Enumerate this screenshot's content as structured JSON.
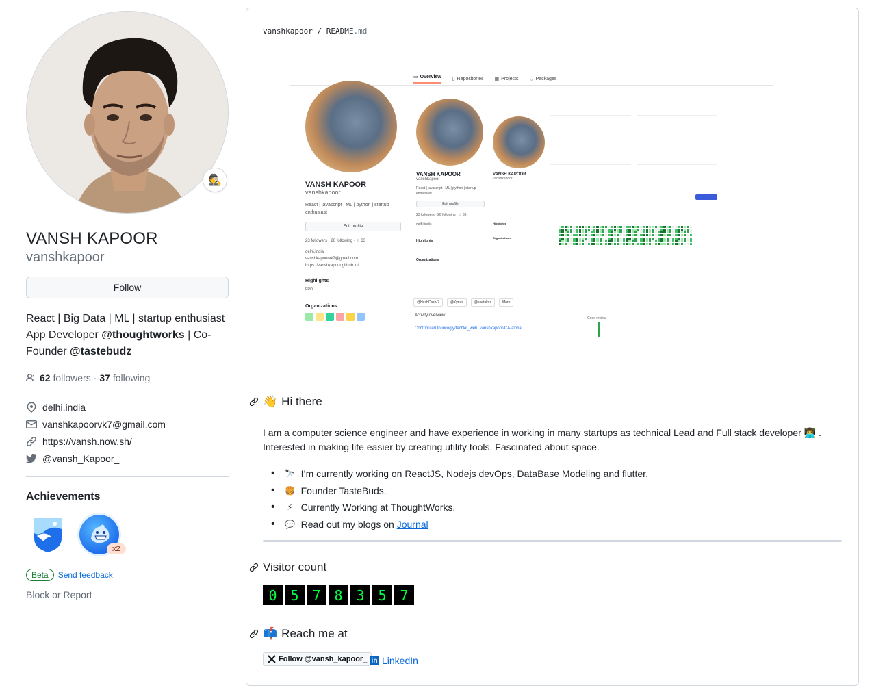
{
  "profile": {
    "name": "VANSH KAPOOR",
    "login": "vanshkapoor",
    "follow_label": "Follow",
    "bio_line1": "React | Big Data | ML | startup enthusiast",
    "bio_line2_pre": "App Developer ",
    "bio_org1": "@thoughtworks",
    "bio_line2_post": " | Co-",
    "bio_line3_pre": "Founder ",
    "bio_org2": "@tastebudz",
    "followers_count": "62",
    "followers_label": "followers",
    "following_count": "37",
    "following_label": "following",
    "location": "delhi,india",
    "email": "vanshkapoorvk7@gmail.com",
    "website": "https://vansh.now.sh/",
    "twitter": "@vansh_Kapoor_",
    "status_emoji": "🕵"
  },
  "achievements": {
    "title": "Achievements",
    "badge2_count": "x2",
    "beta_label": "Beta",
    "feedback_label": "Send feedback",
    "block_label": "Block or Report"
  },
  "readme": {
    "path_user": "vanshkapoor",
    "path_sep": " / ",
    "path_file": "README",
    "path_ext": ".md",
    "shot": {
      "tabs": [
        "Overview",
        "Repositories",
        "Projects",
        "Packages"
      ],
      "name": "VANSH KAPOOR",
      "login": "vanshkapoor",
      "bio": "React | javascript | ML | python | startup enthusiast",
      "edit": "Edit profile",
      "followers": "23 followers · 26 following · ☆ 33",
      "location": "delhi,india",
      "email": "vanshkapoorvk7@gmail.com",
      "site": "https://vanshkapoor.github.io/",
      "highlights": "Highlights",
      "pro": "PRO",
      "orgs": "Organizations",
      "activity": "Activity overview",
      "contrib": "Contributed to incogly/techkit_web, vanshkapoor/CA-alpha,",
      "code_review": "Code review",
      "chips": [
        "@HashCash-2",
        "@Kynus",
        "@asetaltas",
        "More"
      ]
    },
    "hi_title": "Hi there",
    "hi_emoji": "👋",
    "intro": "I am a computer science engineer and have experience in working in many startups as technical Lead and Full stack developer 👨‍💻 . Interested in making life easier by creating utility tools. Fascinated about space.",
    "bullets": [
      {
        "emoji": "🔭",
        "text": "I’m currently working on ReactJS, Nodejs devOps, DataBase Modeling and flutter."
      },
      {
        "emoji": "🍔",
        "text": "Founder TasteBuds."
      },
      {
        "emoji": "⚡",
        "text": "Currently Working at ThoughtWorks."
      },
      {
        "emoji": "💬",
        "text": "Read out my blogs on "
      }
    ],
    "journal_link": "Journal",
    "visitor_title": "Visitor count",
    "visitor_digits": [
      "0",
      "5",
      "7",
      "8",
      "3",
      "5",
      "7"
    ],
    "reach_title": "Reach me at",
    "reach_emoji": "📫",
    "x_follow": "Follow @vansh_kapoor_",
    "linkedin": "LinkedIn"
  }
}
